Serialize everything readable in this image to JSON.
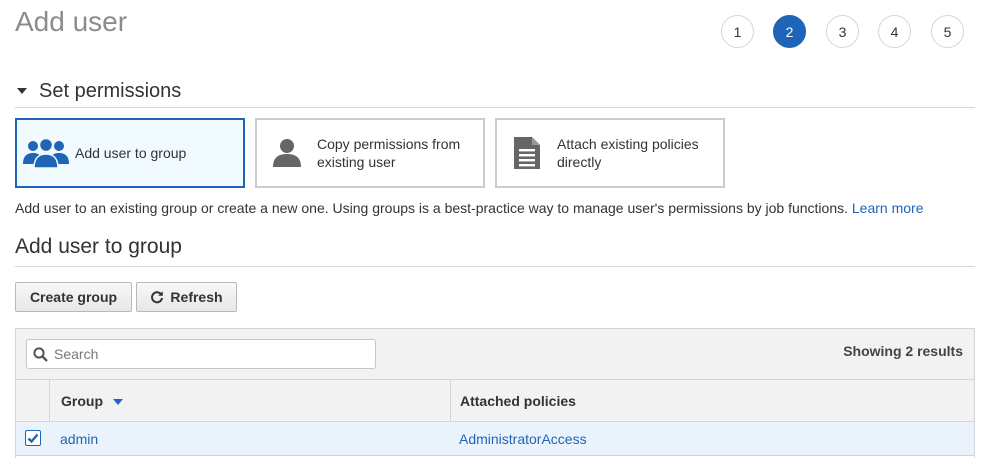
{
  "page": {
    "title": "Add user"
  },
  "steps": [
    {
      "label": "1",
      "active": false
    },
    {
      "label": "2",
      "active": true
    },
    {
      "label": "3",
      "active": false
    },
    {
      "label": "4",
      "active": false
    },
    {
      "label": "5",
      "active": false
    }
  ],
  "permissions": {
    "section_title": "Set permissions",
    "options": [
      {
        "label": "Add user to group",
        "icon": "users-group-icon",
        "selected": true
      },
      {
        "label": "Copy permissions from existing user",
        "icon": "user-icon",
        "selected": false
      },
      {
        "label": "Attach existing policies directly",
        "icon": "document-icon",
        "selected": false
      }
    ],
    "description": "Add user to an existing group or create a new one. Using groups is a best-practice way to manage user's permissions by job functions.",
    "learn_more": "Learn more"
  },
  "group_section": {
    "title": "Add user to group",
    "create_button": "Create group",
    "refresh_button": "Refresh",
    "refresh_icon": "refresh-icon",
    "search_placeholder": "Search",
    "results_text": "Showing 2 results",
    "columns": {
      "group": "Group",
      "policies": "Attached policies"
    },
    "sort_indicator": "caret-down-icon",
    "rows": [
      {
        "group": "admin",
        "policies": "AdministratorAccess",
        "checked": true
      }
    ]
  },
  "colors": {
    "accent": "#1f65b7",
    "selected_bg": "#f1faff",
    "row_selected_bg": "#eaf3fc",
    "header_bg": "#f2f2f2"
  }
}
